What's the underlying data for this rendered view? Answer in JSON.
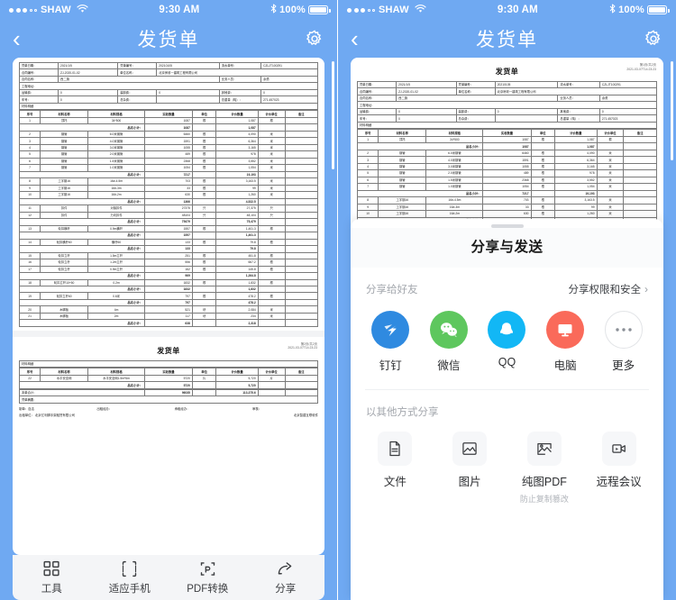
{
  "status_bar": {
    "carrier": "SHAW",
    "time": "9:30 AM",
    "battery_text": "100%",
    "signal_dots_filled": 3,
    "signal_dots_total": 5,
    "wifi_icon": "wifi-icon",
    "bluetooth_icon": "bluetooth-icon"
  },
  "nav": {
    "back_icon": "chevron-left-icon",
    "title": "发货单",
    "settings_icon": "gear-icon"
  },
  "document": {
    "title": "发货单",
    "page_meta_line1": "第1页/共2页",
    "page_meta_line2": "2021-03-07T14:23:23",
    "page2_meta_line1": "第2页/共2页",
    "page2_meta_line2": "2021-03-07T14:23:23",
    "header_fields": [
      [
        {
          "label": "凭单日期：",
          "value": "2021/1/5"
        },
        {
          "label": "凭单编号：",
          "value": "20210105"
        },
        {
          "label": "流水单号：",
          "value": "CZLJT100291"
        }
      ],
      [
        {
          "label": "合同编号：",
          "value": "ZJ-2020-01-02"
        },
        {
          "label": "单位名称：",
          "value": "北京房收一建筑工程有限公司"
        }
      ],
      [
        {
          "label": "合同名称：",
          "value": "西二旗"
        },
        {
          "label": "业务人员：",
          "value": "余勇"
        }
      ],
      [
        {
          "label": "工程地址：",
          "value": ""
        }
      ],
      [
        {
          "label": "运输费：",
          "value": "0"
        },
        {
          "label": "装卸费：",
          "value": "0"
        },
        {
          "label": "其他费：",
          "value": "0"
        }
      ],
      [
        {
          "label": "车号：",
          "value": "0"
        },
        {
          "label": "总杂费：",
          "value": ""
        },
        {
          "label": "总重量（吨）：",
          "value": "271.457023"
        }
      ]
    ],
    "section_label": "材料明细",
    "columns": [
      "序号",
      "材料名称",
      "材料规格",
      "实收数量",
      "单位",
      "计价数量",
      "计价单位",
      "备注"
    ],
    "subtotal_label": "品名小计：",
    "rows": [
      {
        "no": "1",
        "name": "顶托",
        "spec": "34*500",
        "qty": "1087",
        "unit": "根",
        "price_qty": "1,087",
        "price_unit": "根",
        "note": ""
      },
      {
        "subtotal": true,
        "qty": "1087",
        "price_qty": "1,087"
      },
      {
        "no": "2",
        "name": "钢管",
        "spec": "6.0米钢管",
        "qty": "6460",
        "unit": "根",
        "price_qty": "4,090",
        "price_unit": "米",
        "note": ""
      },
      {
        "no": "3",
        "name": "钢管",
        "spec": "4.0米钢管",
        "qty": "1591",
        "unit": "根",
        "price_qty": "6,364",
        "price_unit": "米",
        "note": ""
      },
      {
        "no": "4",
        "name": "钢管",
        "spec": "3.0米钢管",
        "qty": "1055",
        "unit": "根",
        "price_qty": "3,165",
        "price_unit": "米",
        "note": ""
      },
      {
        "no": "5",
        "name": "钢管",
        "spec": "2.0米钢管",
        "qty": "489",
        "unit": "根",
        "price_qty": "978",
        "price_unit": "米",
        "note": ""
      },
      {
        "no": "6",
        "name": "钢管",
        "spec": "1.5米钢管",
        "qty": "2368",
        "unit": "根",
        "price_qty": "3,552",
        "price_unit": "米",
        "note": ""
      },
      {
        "no": "7",
        "name": "钢管",
        "spec": "1.0米钢管",
        "qty": "1054",
        "unit": "根",
        "price_qty": "1,054",
        "price_unit": "米",
        "note": ""
      },
      {
        "subtotal": true,
        "qty": "7217",
        "price_qty": "19,193"
      },
      {
        "no": "8",
        "name": "工字钢16",
        "spec": "16#-4.5m",
        "qty": "703",
        "unit": "根",
        "price_qty": "3,163.5",
        "price_unit": "米",
        "note": ""
      },
      {
        "no": "9",
        "name": "工字钢16",
        "spec": "16#-3m",
        "qty": "33",
        "unit": "根",
        "price_qty": "99",
        "price_unit": "米",
        "note": ""
      },
      {
        "no": "10",
        "name": "工字钢16",
        "spec": "16#-2m",
        "qty": "630",
        "unit": "根",
        "price_qty": "1,260",
        "price_unit": "米",
        "note": ""
      },
      {
        "subtotal": true,
        "qty": "1366",
        "price_qty": "4,522.5"
      },
      {
        "no": "11",
        "name": "扣件",
        "spec": "对接扣件",
        "qty": "27375",
        "unit": "只",
        "price_qty": "27,375",
        "price_unit": "只",
        "note": ""
      },
      {
        "no": "12",
        "name": "扣件",
        "spec": "万向扣件",
        "qty": "48104",
        "unit": "只",
        "price_qty": "48,104",
        "price_unit": "只",
        "note": ""
      },
      {
        "subtotal": true,
        "qty": "75479",
        "price_qty": "75,479"
      },
      {
        "no": "13",
        "name": "轮扣横杆",
        "spec": "0.9m横杆",
        "qty": "1557",
        "unit": "根",
        "price_qty": "1,401.3",
        "price_unit": "根",
        "note": ""
      },
      {
        "subtotal": true,
        "qty": "1557",
        "price_qty": "1,401.3"
      },
      {
        "no": "14",
        "name": "轮扣横杆60",
        "spec": "横杆60",
        "qty": "133",
        "unit": "根",
        "price_qty": "79.8",
        "price_unit": "根",
        "note": ""
      },
      {
        "subtotal": true,
        "qty": "133",
        "price_qty": "79.8"
      },
      {
        "no": "15",
        "name": "轮扣立杆",
        "spec": "1.5m立杆",
        "qty": "251",
        "unit": "根",
        "price_qty": "451.8",
        "price_unit": "根",
        "note": ""
      },
      {
        "no": "16",
        "name": "轮扣立杆",
        "spec": "1.2m立杆",
        "qty": "556",
        "unit": "根",
        "price_qty": "667.2",
        "price_unit": "根",
        "note": ""
      },
      {
        "no": "17",
        "name": "轮扣立杆",
        "spec": "0.9m立杆",
        "qty": "162",
        "unit": "根",
        "price_qty": "145.8",
        "price_unit": "根",
        "note": ""
      },
      {
        "subtotal": true,
        "qty": "969",
        "price_qty": "1,264.8"
      },
      {
        "no": "18",
        "name": "轮扣立杆10+50",
        "spec": "0.2m",
        "qty": "1832",
        "unit": "根",
        "price_qty": "1,832",
        "price_unit": "根",
        "note": ""
      },
      {
        "subtotal": true,
        "qty": "1832",
        "price_qty": "1,832"
      },
      {
        "no": "19",
        "name": "轮扣立杆60",
        "spec": "0.6米",
        "qty": "797",
        "unit": "根",
        "price_qty": "478.2",
        "price_unit": "根",
        "note": ""
      },
      {
        "subtotal": true,
        "qty": "797",
        "price_qty": "478.2"
      },
      {
        "no": "20",
        "name": "木脚板",
        "spec": "4m",
        "qty": "521",
        "unit": "块",
        "price_qty": "2,084",
        "price_unit": "米",
        "note": ""
      },
      {
        "no": "21",
        "name": "木脚板",
        "spec": "2m",
        "qty": "117",
        "unit": "块",
        "price_qty": "234",
        "price_unit": "米",
        "note": ""
      },
      {
        "subtotal": true,
        "qty": "638",
        "price_qty": "2,318"
      }
    ],
    "page2_rows": [
      {
        "no": "22",
        "name": "水平安全网",
        "spec": "水平安全网1.5m*6m",
        "qty": "5720",
        "unit": "片",
        "price_qty": "5,720",
        "price_unit": "片",
        "note": ""
      },
      {
        "subtotal": true,
        "qty": "5720",
        "price_qty": "5,720"
      }
    ],
    "page2_total_label": "本单合计：",
    "page2_total_qty": "96035",
    "page2_total_price": "113,375.6",
    "page2_summary_label": "凭单摘要：",
    "page2_footer_fields": [
      {
        "label": "制单：",
        "value": "自洁"
      },
      {
        "label": "出租经办：",
        "value": ""
      },
      {
        "label": "承租经办：",
        "value": ""
      },
      {
        "label": "审核：",
        "value": ""
      }
    ],
    "page2_footer_company_label": "出租单位：",
    "page2_footer_company": "北京亿利脚手架租赁有限公司",
    "page2_footer_right": "北京智建互联软件"
  },
  "toolbar": {
    "items": [
      {
        "label": "工具",
        "icon": "grid-tools-icon"
      },
      {
        "label": "适应手机",
        "icon": "fit-phone-icon"
      },
      {
        "label": "PDF转换",
        "icon": "pdf-convert-icon"
      },
      {
        "label": "分享",
        "icon": "share-arrow-icon"
      }
    ]
  },
  "share_sheet": {
    "title": "分享与发送",
    "section_friends_label": "分享给好友",
    "permission_link": "分享权限和安全",
    "permission_chevron": "chevron-right-icon",
    "apps": [
      {
        "label": "钉钉",
        "icon": "dingtalk-icon",
        "color": "#2f8ae0"
      },
      {
        "label": "微信",
        "icon": "wechat-icon",
        "color": "#5ec75e"
      },
      {
        "label": "QQ",
        "icon": "qq-icon",
        "color": "#12b7f5"
      },
      {
        "label": "电脑",
        "icon": "computer-icon",
        "color": "#fa6a5a"
      },
      {
        "label": "更多",
        "icon": "ellipsis-icon",
        "color": "#ffffff"
      }
    ],
    "section_other_label": "以其他方式分享",
    "other": [
      {
        "label": "文件",
        "sub": "",
        "icon": "file-icon"
      },
      {
        "label": "图片",
        "sub": "",
        "icon": "image-icon"
      },
      {
        "label": "纯图PDF",
        "sub": "防止复制篡改",
        "icon": "image-pdf-icon"
      },
      {
        "label": "远程会议",
        "sub": "",
        "icon": "video-meeting-icon"
      }
    ]
  },
  "colors": {
    "brand_blue": "#6fa9f2",
    "sheet_bg": "#ffffff",
    "toolbar_bg": "#f4f5f7"
  }
}
